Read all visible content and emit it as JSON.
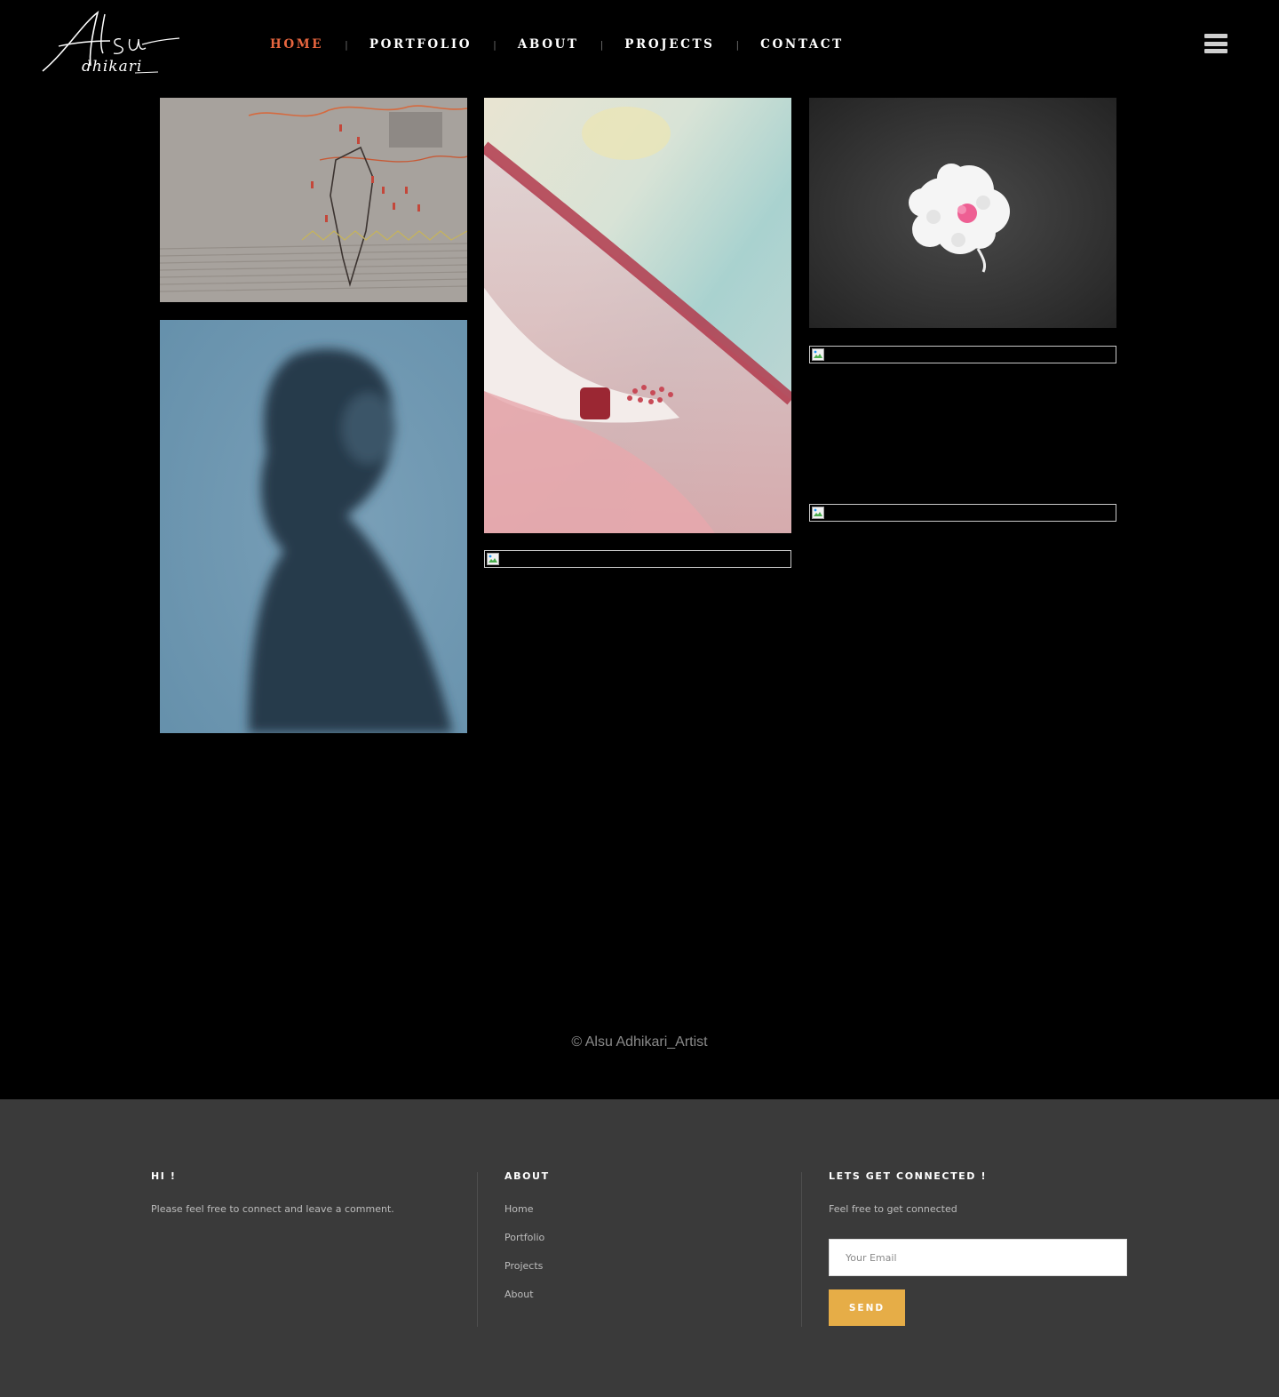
{
  "header": {
    "logo_alt": "Alsu Adhikari",
    "nav": [
      {
        "label": "HOME",
        "active": true
      },
      {
        "label": "PORTFOLIO",
        "active": false
      },
      {
        "label": "ABOUT",
        "active": false
      },
      {
        "label": "PROJECTS",
        "active": false
      },
      {
        "label": "CONTACT",
        "active": false
      }
    ],
    "nav_separator": "|",
    "menu_icon": "hamburger-menu-icon"
  },
  "gallery": {
    "images": [
      {
        "subject": "embroidery on fabric",
        "loaded": true
      },
      {
        "subject": "watercolor painting of a hand holding flowers",
        "loaded": true
      },
      {
        "subject": "white cotton flower with pink embroidery",
        "loaded": true
      },
      {
        "subject": "blurred portrait silhouette on blue",
        "loaded": true
      },
      {
        "subject": "",
        "loaded": false
      },
      {
        "subject": "",
        "loaded": false
      },
      {
        "subject": "",
        "loaded": false
      }
    ],
    "broken_image_icon": "broken-image-icon"
  },
  "copyright": "© Alsu Adhikari_Artist",
  "footer": {
    "col1": {
      "heading": "HI !",
      "text": "Please feel free to connect and leave a comment."
    },
    "col2": {
      "heading": "ABOUT",
      "links": [
        "Home",
        "Portfolio",
        "Projects",
        "About"
      ]
    },
    "col3": {
      "heading": "LETS GET CONNECTED !",
      "text": "Feel free to get connected",
      "email_placeholder": "Your Email",
      "send_label": "SEND"
    }
  },
  "colors": {
    "background": "#000000",
    "nav_active": "#e8663f",
    "footer_bg": "#3a3a3a",
    "send_button": "#e6ad47"
  }
}
